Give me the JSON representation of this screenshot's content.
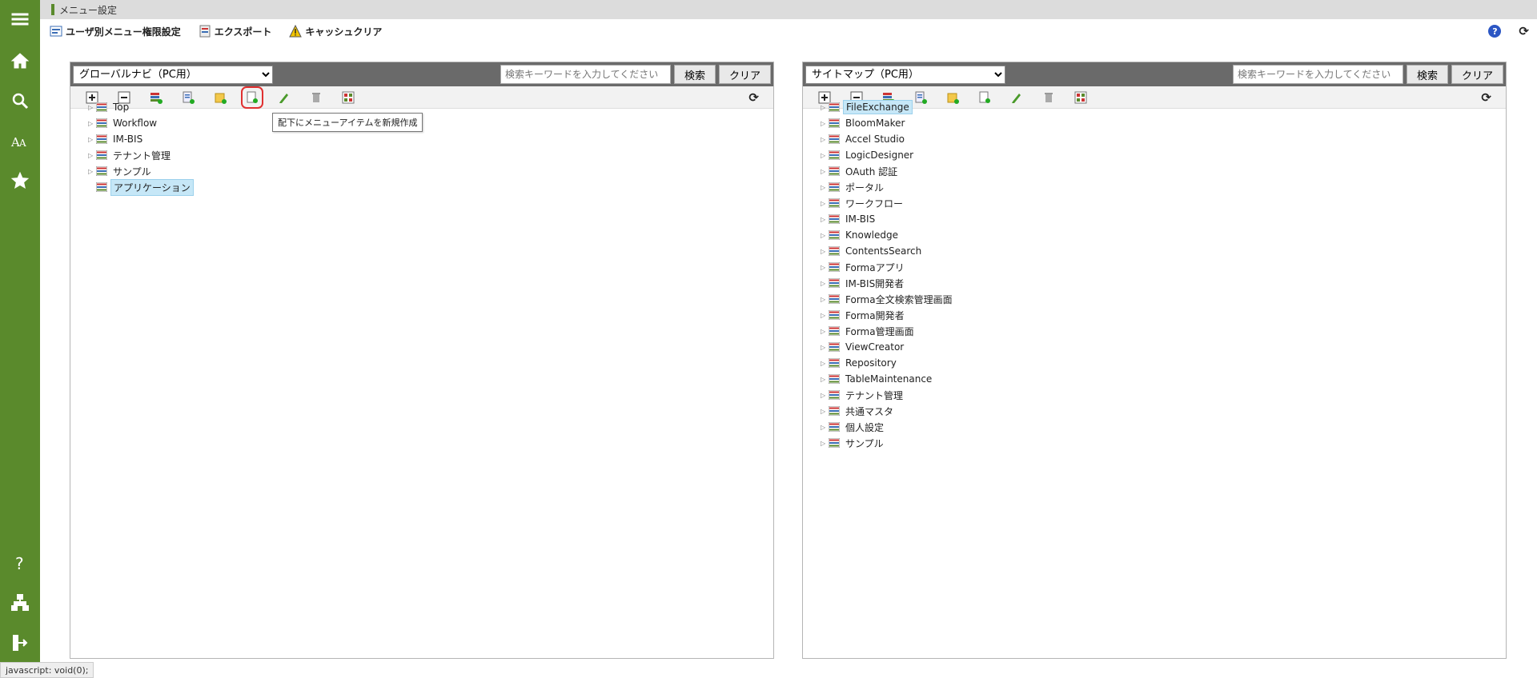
{
  "window": {
    "title": "メニュー設定"
  },
  "toolbar": {
    "items": [
      {
        "label": "ユーザ別メニュー権限設定",
        "icon": "user-menu-icon"
      },
      {
        "label": "エクスポート",
        "icon": "export-icon"
      },
      {
        "label": "キャッシュクリア",
        "icon": "warning-icon"
      }
    ],
    "help_label": "?"
  },
  "colors": {
    "sidebar": "#5a8a2c",
    "accent_red": "#e03030",
    "selection": "#c6e7f7"
  },
  "left_panel": {
    "select_value": "グローバルナビ（PC用）",
    "search_placeholder": "検索キーワードを入力してください",
    "search_button": "検索",
    "clear_button": "クリア",
    "tooltip": "配下にメニューアイテムを新規作成",
    "tools": [
      "expand-all-icon",
      "collapse-all-icon",
      "add-category-icon",
      "add-item-icon",
      "add-folder-icon",
      "add-child-item-icon",
      "edit-pencil-icon",
      "delete-trash-icon",
      "settings-grid-icon"
    ],
    "tree": [
      {
        "label": "Top",
        "expandable": true,
        "selected": false
      },
      {
        "label": "Workflow",
        "expandable": true,
        "selected": false
      },
      {
        "label": "IM-BIS",
        "expandable": true,
        "selected": false
      },
      {
        "label": "テナント管理",
        "expandable": true,
        "selected": false
      },
      {
        "label": "サンプル",
        "expandable": true,
        "selected": false
      },
      {
        "label": "アプリケーション",
        "expandable": false,
        "selected": true
      }
    ]
  },
  "right_panel": {
    "select_value": "サイトマップ（PC用）",
    "search_placeholder": "検索キーワードを入力してください",
    "search_button": "検索",
    "clear_button": "クリア",
    "tree": [
      {
        "label": "FileExchange",
        "selected": true
      },
      {
        "label": "BloomMaker",
        "selected": false
      },
      {
        "label": "Accel Studio",
        "selected": false
      },
      {
        "label": "LogicDesigner",
        "selected": false
      },
      {
        "label": "OAuth 認証",
        "selected": false
      },
      {
        "label": "ポータル",
        "selected": false
      },
      {
        "label": "ワークフロー",
        "selected": false
      },
      {
        "label": "IM-BIS",
        "selected": false
      },
      {
        "label": "Knowledge",
        "selected": false
      },
      {
        "label": "ContentsSearch",
        "selected": false
      },
      {
        "label": "Formaアプリ",
        "selected": false
      },
      {
        "label": "IM-BIS開発者",
        "selected": false
      },
      {
        "label": "Forma全文検索管理画面",
        "selected": false
      },
      {
        "label": "Forma開発者",
        "selected": false
      },
      {
        "label": "Forma管理画面",
        "selected": false
      },
      {
        "label": "ViewCreator",
        "selected": false
      },
      {
        "label": "Repository",
        "selected": false
      },
      {
        "label": "TableMaintenance",
        "selected": false
      },
      {
        "label": "テナント管理",
        "selected": false
      },
      {
        "label": "共通マスタ",
        "selected": false
      },
      {
        "label": "個人設定",
        "selected": false
      },
      {
        "label": "サンプル",
        "selected": false
      }
    ]
  },
  "status_bar": "javascript: void(0);"
}
